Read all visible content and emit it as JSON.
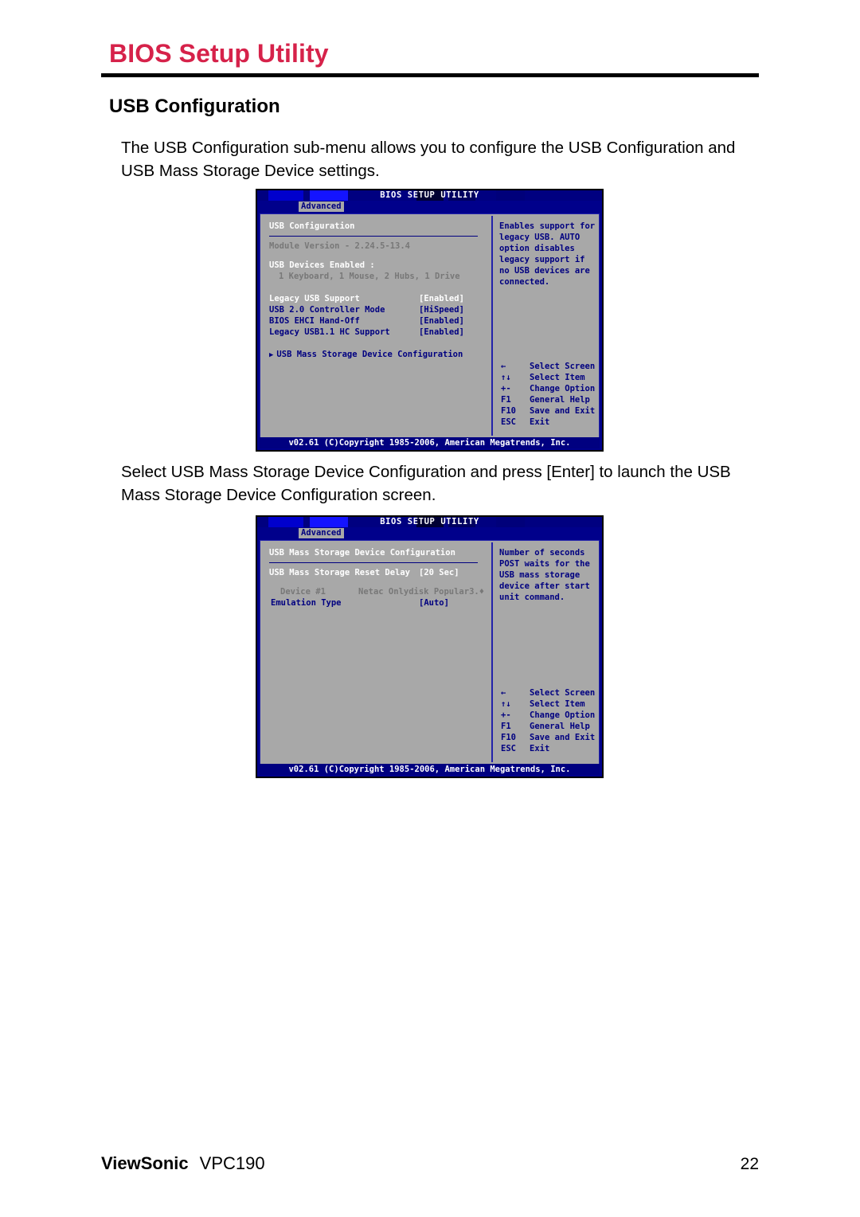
{
  "page": {
    "title": "BIOS Setup Utility",
    "section_title": "USB Configuration",
    "paragraph_1": "The USB Configuration sub-menu allows you to configure the USB Configuration and USB Mass Storage Device settings.",
    "paragraph_2": "Select USB Mass Storage Device Configuration and press [Enter] to launch the USB Mass Storage Device Configuration screen.",
    "footer_brand": "ViewSonic",
    "footer_model": "VPC190",
    "footer_page_number": "22",
    "title_color": "#D6224A"
  },
  "bios_common": {
    "title_bar": "BIOS SETUP UTILITY",
    "tab": "Advanced",
    "copyright": "v02.61 (C)Copyright 1985-2006, American Megatrends, Inc.",
    "legend": [
      {
        "key": "←",
        "desc": "Select Screen"
      },
      {
        "key": "↑↓",
        "desc": "Select Item"
      },
      {
        "key": "+-",
        "desc": "Change Option"
      },
      {
        "key": "F1",
        "desc": "General Help"
      },
      {
        "key": "F10",
        "desc": "Save and Exit"
      },
      {
        "key": "ESC",
        "desc": "Exit"
      }
    ]
  },
  "screen_1": {
    "heading": "USB Configuration",
    "module_version": "Module Version - 2.24.5-13.4",
    "devices_enabled_label": "USB Devices Enabled :",
    "devices_enabled_value": "1 Keyboard, 1 Mouse, 2 Hubs, 1 Drive",
    "settings": [
      {
        "label": "Legacy USB Support",
        "value": "[Enabled]",
        "selected": true
      },
      {
        "label": "USB 2.0 Controller Mode",
        "value": "[HiSpeed]",
        "selected": false
      },
      {
        "label": "BIOS EHCI Hand-Off",
        "value": "[Enabled]",
        "selected": false
      },
      {
        "label": "Legacy USB1.1 HC Support",
        "value": "[Enabled]",
        "selected": false
      }
    ],
    "submenu": "USB Mass Storage Device Configuration",
    "help": [
      "Enables support for",
      "legacy USB. AUTO",
      "option disables",
      "legacy support if",
      "no USB devices are",
      "connected."
    ]
  },
  "screen_2": {
    "heading": "USB Mass Storage Device Configuration",
    "reset_delay_label": "USB Mass Storage Reset Delay",
    "reset_delay_value": "[20 Sec]",
    "device_label": "Device #1",
    "device_value": "Netac Onlydisk Popular3.♦",
    "emulation_label": "Emulation Type",
    "emulation_value": "[Auto]",
    "help": [
      "Number of seconds",
      "POST waits for the",
      "USB mass storage",
      "device after start",
      "unit command."
    ]
  }
}
